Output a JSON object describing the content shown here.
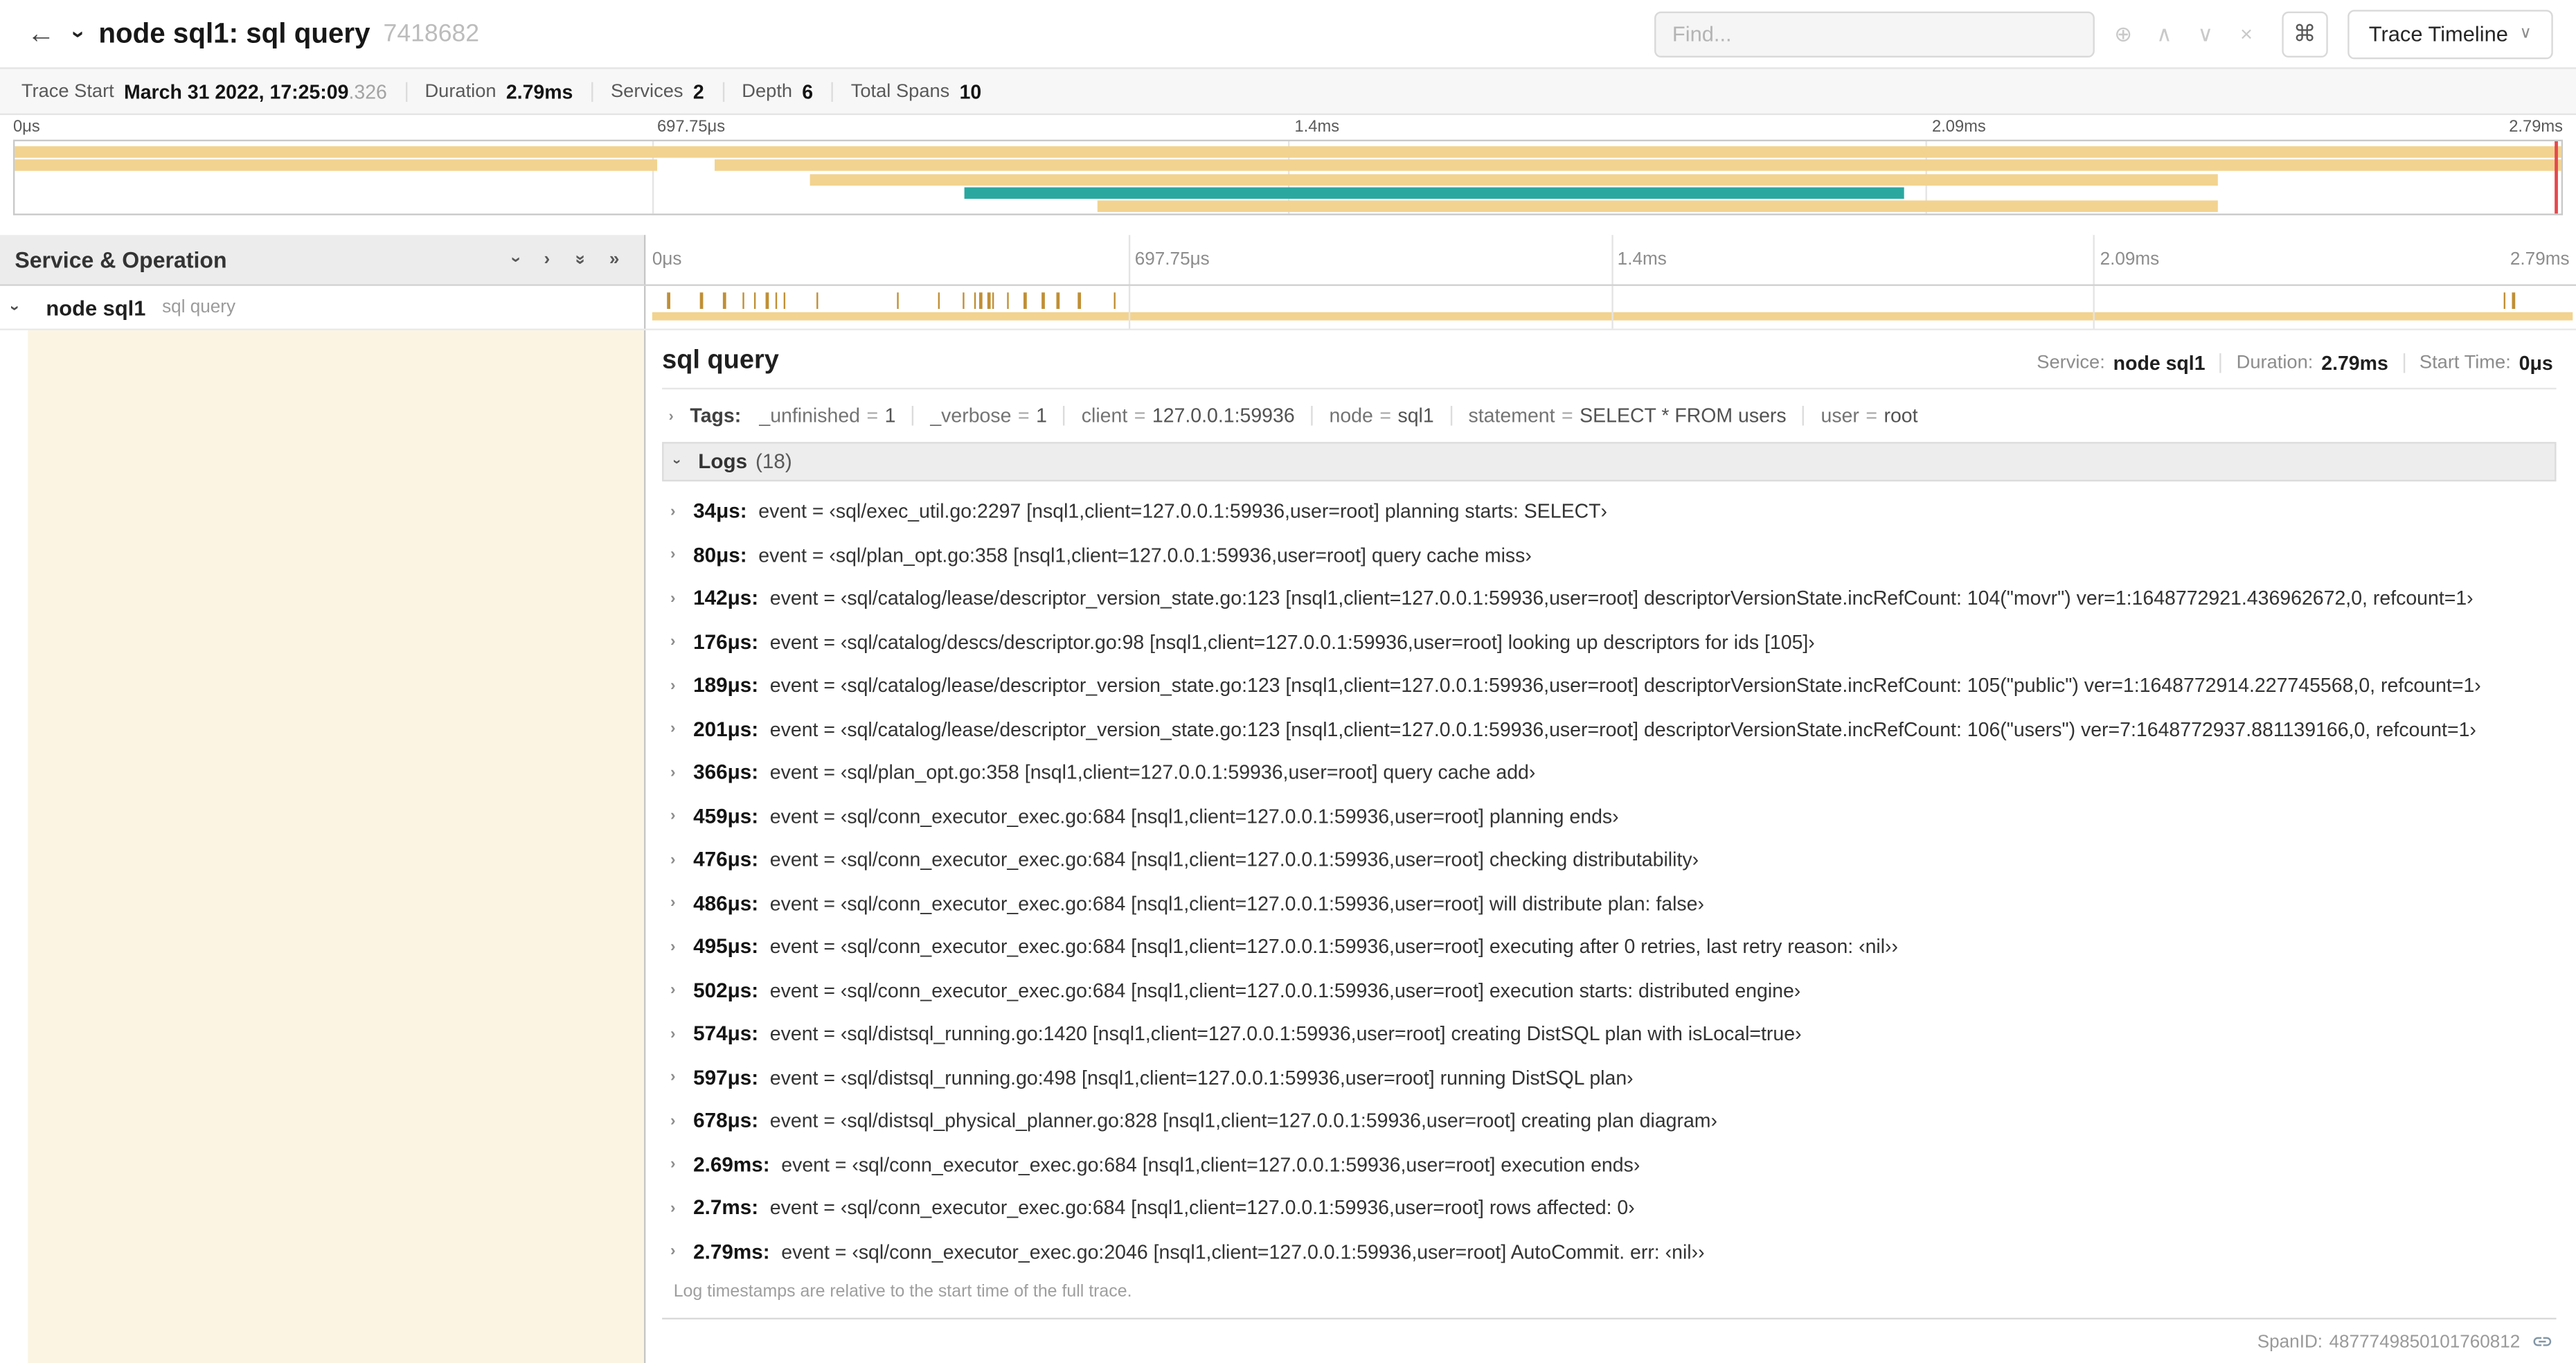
{
  "colors": {
    "span_bar": "#f2d38f",
    "child_flow_bar": "#2aa8a0",
    "detail_accent": "#fbf4e3",
    "log_marker": "#c08f35",
    "view_range_end": "#e5484d"
  },
  "glyphs": {
    "back_arrow": "←",
    "chevron": "›",
    "double_chevron": "»",
    "command": "⌘",
    "caret_down": "∨"
  },
  "header": {
    "title": "node sql1: sql query",
    "trace_id": "7418682",
    "find_placeholder": "Find...",
    "find_controls": [
      {
        "name": "focus-matches-icon",
        "glyph": "⊕"
      },
      {
        "name": "previous-match-icon",
        "glyph": "∧"
      },
      {
        "name": "next-match-icon",
        "glyph": "∨"
      },
      {
        "name": "clear-search-icon",
        "glyph": "×"
      }
    ],
    "view_button_label": "Trace Timeline"
  },
  "summary": {
    "items": [
      {
        "label": "Trace Start",
        "value": "March 31 2022, 17:25:09",
        "suffix": ".326"
      },
      {
        "label": "Duration",
        "value": "2.79ms"
      },
      {
        "label": "Services",
        "value": "2"
      },
      {
        "label": "Depth",
        "value": "6"
      },
      {
        "label": "Total Spans",
        "value": "10"
      }
    ]
  },
  "timeline": {
    "left_title": "Service & Operation",
    "ticks": [
      {
        "label": "0μs",
        "pos": 0
      },
      {
        "label": "697.75μs",
        "pos": 0.25
      },
      {
        "label": "1.4ms",
        "pos": 0.5
      },
      {
        "label": "2.09ms",
        "pos": 0.75
      },
      {
        "label": "2.79ms",
        "pos": 1
      }
    ],
    "gridlines": [
      0.25,
      0.5,
      0.75
    ],
    "controls": [
      {
        "name": "collapse-one-icon",
        "glyph": "›",
        "rotate": true
      },
      {
        "name": "expand-one-icon",
        "glyph": "›",
        "rotate": false
      },
      {
        "name": "collapse-all-icon",
        "glyph": "»",
        "rotate": true
      },
      {
        "name": "expand-all-icon",
        "glyph": "»",
        "rotate": false
      }
    ]
  },
  "minimap": {
    "rows": [
      [
        {
          "start": 0,
          "end": 1,
          "color": "tan"
        }
      ],
      [
        {
          "start": 0,
          "end": 0.252,
          "color": "tan"
        },
        {
          "start": 0.275,
          "end": 1,
          "color": "tan"
        }
      ],
      [
        {
          "start": 0.312,
          "end": 0.865,
          "color": "tan"
        }
      ],
      [
        {
          "start": 0.373,
          "end": 0.742,
          "color": "teal"
        }
      ],
      [
        {
          "start": 0.425,
          "end": 0.865,
          "color": "tan"
        }
      ]
    ]
  },
  "span_row": {
    "service": "node sql1",
    "operation": "sql query",
    "log_markers": [
      0.012,
      0.029,
      0.041,
      0.051,
      0.057,
      0.063,
      0.068,
      0.072,
      0.089,
      0.131,
      0.152,
      0.165,
      0.171,
      0.174,
      0.178,
      0.18,
      0.188,
      0.197,
      0.206,
      0.214,
      0.225,
      0.243,
      0.963,
      0.968
    ]
  },
  "detail": {
    "operation": "sql query",
    "meta": [
      {
        "label": "Service:",
        "value": "node sql1"
      },
      {
        "label": "Duration:",
        "value": "2.79ms"
      },
      {
        "label": "Start Time:",
        "value": "0μs"
      }
    ],
    "tags_label": "Tags:",
    "tag_equals": "=",
    "tags": [
      {
        "key": "_unfinished",
        "value": "1"
      },
      {
        "key": "_verbose",
        "value": "1"
      },
      {
        "key": "client",
        "value": "127.0.0.1:59936"
      },
      {
        "key": "node",
        "value": "sql1"
      },
      {
        "key": "statement",
        "value": "SELECT * FROM users"
      },
      {
        "key": "user",
        "value": "root"
      }
    ],
    "logs_label": "Logs",
    "logs_count": "(18)",
    "logs": [
      {
        "time": "34μs:",
        "text": "event = ‹sql/exec_util.go:2297 [nsql1,client=127.0.0.1:59936,user=root] planning starts: SELECT›"
      },
      {
        "time": "80μs:",
        "text": "event = ‹sql/plan_opt.go:358 [nsql1,client=127.0.0.1:59936,user=root] query cache miss›"
      },
      {
        "time": "142μs:",
        "text": "event = ‹sql/catalog/lease/descriptor_version_state.go:123 [nsql1,client=127.0.0.1:59936,user=root] descriptorVersionState.incRefCount: 104(\"movr\") ver=1:1648772921.436962672,0, refcount=1›"
      },
      {
        "time": "176μs:",
        "text": "event = ‹sql/catalog/descs/descriptor.go:98 [nsql1,client=127.0.0.1:59936,user=root] looking up descriptors for ids [105]›"
      },
      {
        "time": "189μs:",
        "text": "event = ‹sql/catalog/lease/descriptor_version_state.go:123 [nsql1,client=127.0.0.1:59936,user=root] descriptorVersionState.incRefCount: 105(\"public\") ver=1:1648772914.227745568,0, refcount=1›"
      },
      {
        "time": "201μs:",
        "text": "event = ‹sql/catalog/lease/descriptor_version_state.go:123 [nsql1,client=127.0.0.1:59936,user=root] descriptorVersionState.incRefCount: 106(\"users\") ver=7:1648772937.881139166,0, refcount=1›"
      },
      {
        "time": "366μs:",
        "text": "event = ‹sql/plan_opt.go:358 [nsql1,client=127.0.0.1:59936,user=root] query cache add›"
      },
      {
        "time": "459μs:",
        "text": "event = ‹sql/conn_executor_exec.go:684 [nsql1,client=127.0.0.1:59936,user=root] planning ends›"
      },
      {
        "time": "476μs:",
        "text": "event = ‹sql/conn_executor_exec.go:684 [nsql1,client=127.0.0.1:59936,user=root] checking distributability›"
      },
      {
        "time": "486μs:",
        "text": "event = ‹sql/conn_executor_exec.go:684 [nsql1,client=127.0.0.1:59936,user=root] will distribute plan: false›"
      },
      {
        "time": "495μs:",
        "text": "event = ‹sql/conn_executor_exec.go:684 [nsql1,client=127.0.0.1:59936,user=root] executing after 0 retries, last retry reason: ‹nil››"
      },
      {
        "time": "502μs:",
        "text": "event = ‹sql/conn_executor_exec.go:684 [nsql1,client=127.0.0.1:59936,user=root] execution starts: distributed engine›"
      },
      {
        "time": "574μs:",
        "text": "event = ‹sql/distsql_running.go:1420 [nsql1,client=127.0.0.1:59936,user=root] creating DistSQL plan with isLocal=true›"
      },
      {
        "time": "597μs:",
        "text": "event = ‹sql/distsql_running.go:498 [nsql1,client=127.0.0.1:59936,user=root] running DistSQL plan›"
      },
      {
        "time": "678μs:",
        "text": "event = ‹sql/distsql_physical_planner.go:828 [nsql1,client=127.0.0.1:59936,user=root] creating plan diagram›"
      },
      {
        "time": "2.69ms:",
        "text": "event = ‹sql/conn_executor_exec.go:684 [nsql1,client=127.0.0.1:59936,user=root] execution ends›"
      },
      {
        "time": "2.7ms:",
        "text": "event = ‹sql/conn_executor_exec.go:684 [nsql1,client=127.0.0.1:59936,user=root] rows affected: 0›"
      },
      {
        "time": "2.79ms:",
        "text": "event = ‹sql/conn_executor_exec.go:2046 [nsql1,client=127.0.0.1:59936,user=root] AutoCommit. err: ‹nil››"
      }
    ],
    "footnote": "Log timestamps are relative to the start time of the full trace.",
    "span_id_label": "SpanID:",
    "span_id": "4877749850101760812"
  }
}
